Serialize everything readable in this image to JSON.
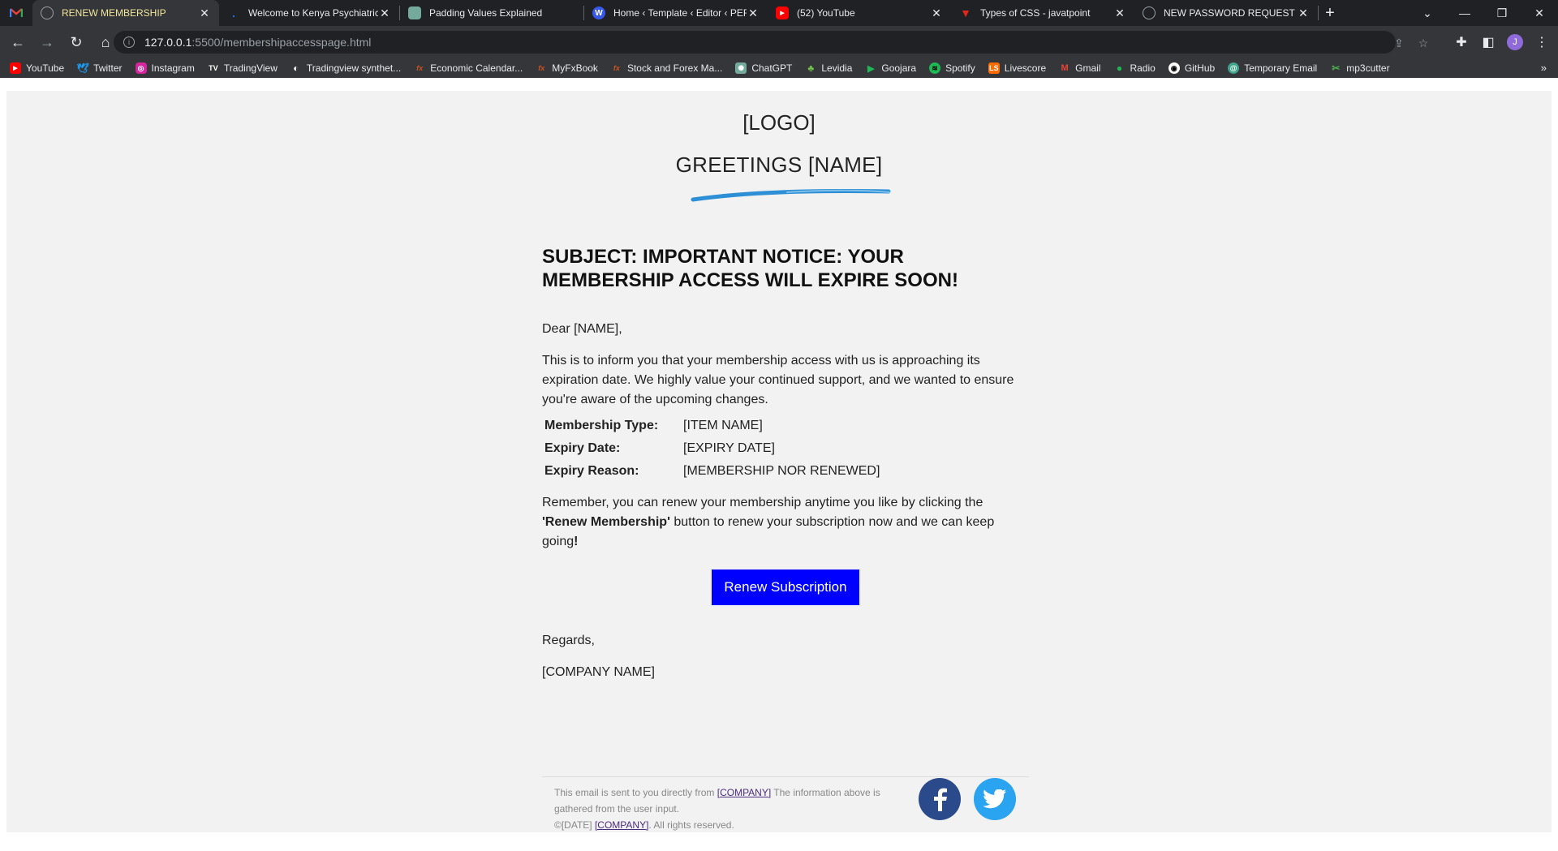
{
  "browser": {
    "tabs": [
      {
        "title": "RENEW MEMBERSHIP",
        "icon": "globe-icon",
        "color": "#9aa0a6",
        "active": true
      },
      {
        "title": "Welcome to Kenya Psychiatric A",
        "icon": "dot-icon",
        "color": "#1a73e8"
      },
      {
        "title": "Padding Values Explained",
        "icon": "chatgpt-icon",
        "color": "#74aa9c"
      },
      {
        "title": "Home ‹ Template ‹ Editor ‹ PER",
        "icon": "wordpress-icon",
        "color": "#3858e9"
      },
      {
        "title": "(52) YouTube",
        "icon": "youtube-icon",
        "color": "#ff0000"
      },
      {
        "title": "Types of CSS - javatpoint",
        "icon": "javatpoint-icon",
        "color": "#e0261b"
      },
      {
        "title": "NEW PASSWORD REQUEST",
        "icon": "globe-icon",
        "color": "#9aa0a6"
      }
    ],
    "gmail_icon": "gmail-icon",
    "url_host": "127.0.0.1",
    "url_rest": ":5500/membershipaccesspage.html",
    "profile_initial": "J",
    "bookmarks": [
      {
        "label": "YouTube",
        "icon": "youtube-icon",
        "color": "#ff0000"
      },
      {
        "label": "Twitter",
        "icon": "twitter-icon",
        "color": "#1d9bf0"
      },
      {
        "label": "Instagram",
        "icon": "instagram-icon",
        "color": "#d6249f"
      },
      {
        "label": "TradingView",
        "icon": "tradingview-icon",
        "color": "#131722"
      },
      {
        "label": "Tradingview synthet...",
        "icon": "moon-icon",
        "color": "#444"
      },
      {
        "label": "Economic Calendar...",
        "icon": "fx-icon",
        "color": "#c8541e"
      },
      {
        "label": "MyFxBook",
        "icon": "fx-icon",
        "color": "#c8541e"
      },
      {
        "label": "Stock and Forex Ma...",
        "icon": "fx-icon",
        "color": "#c8541e"
      },
      {
        "label": "ChatGPT",
        "icon": "chatgpt-icon",
        "color": "#74aa9c"
      },
      {
        "label": "Levidia",
        "icon": "levidia-icon",
        "color": "#3a7d2a"
      },
      {
        "label": "Goojara",
        "icon": "play-icon",
        "color": "#1db954"
      },
      {
        "label": "Spotify",
        "icon": "spotify-icon",
        "color": "#1db954"
      },
      {
        "label": "Livescore",
        "icon": "livescore-icon",
        "color": "#ff6b00"
      },
      {
        "label": "Gmail",
        "icon": "gmail-icon",
        "color": "#ea4335"
      },
      {
        "label": "Radio",
        "icon": "radio-icon",
        "color": "#1db954"
      },
      {
        "label": "GitHub",
        "icon": "github-icon",
        "color": "#ffffff"
      },
      {
        "label": "Temporary Email",
        "icon": "mail-icon",
        "color": "#3fa28a"
      },
      {
        "label": "mp3cutter",
        "icon": "mp3cutter-icon",
        "color": "#4caf50"
      }
    ]
  },
  "email": {
    "logo": "[LOGO]",
    "greeting": "GREETINGS [NAME]",
    "subject": "SUBJECT: IMPORTANT NOTICE: YOUR MEMBERSHIP ACCESS WILL EXPIRE SOON!",
    "salutation": "Dear [NAME],",
    "intro": "This is to inform you that your membership access with us is approaching its expiration date. We highly value your continued support, and we wanted to ensure you're aware of the upcoming changes.",
    "details": [
      {
        "label": "Membership Type:",
        "value": "[ITEM NAME]"
      },
      {
        "label": "Expiry Date:",
        "value": "[EXPIRY DATE]"
      },
      {
        "label": "Expiry Reason:",
        "value": "[MEMBERSHIP NOR RENEWED]"
      }
    ],
    "reminder_pre": "Remember, you can renew your membership anytime you like by clicking the ",
    "reminder_bold": "'Renew Membership'",
    "reminder_post": " button to renew your subscription now and we can keep going",
    "reminder_end": "!",
    "button_label": "Renew Subscription",
    "regards": "Regards,",
    "company": "[COMPANY NAME]",
    "footer": {
      "line1_pre": "This email is sent to you directly from ",
      "line1_link": "[COMPANY]",
      "line1_post": " The information above is gathered from the user input.",
      "line2_pre": "©[DATE] ",
      "line2_link": "[COMPANY]",
      "line2_post": ". All rights reserved."
    },
    "colors": {
      "button": "#0000ff",
      "brush": "#2d8fd5",
      "facebook": "#2b4a8b",
      "twitter": "#2aa3f0"
    }
  }
}
